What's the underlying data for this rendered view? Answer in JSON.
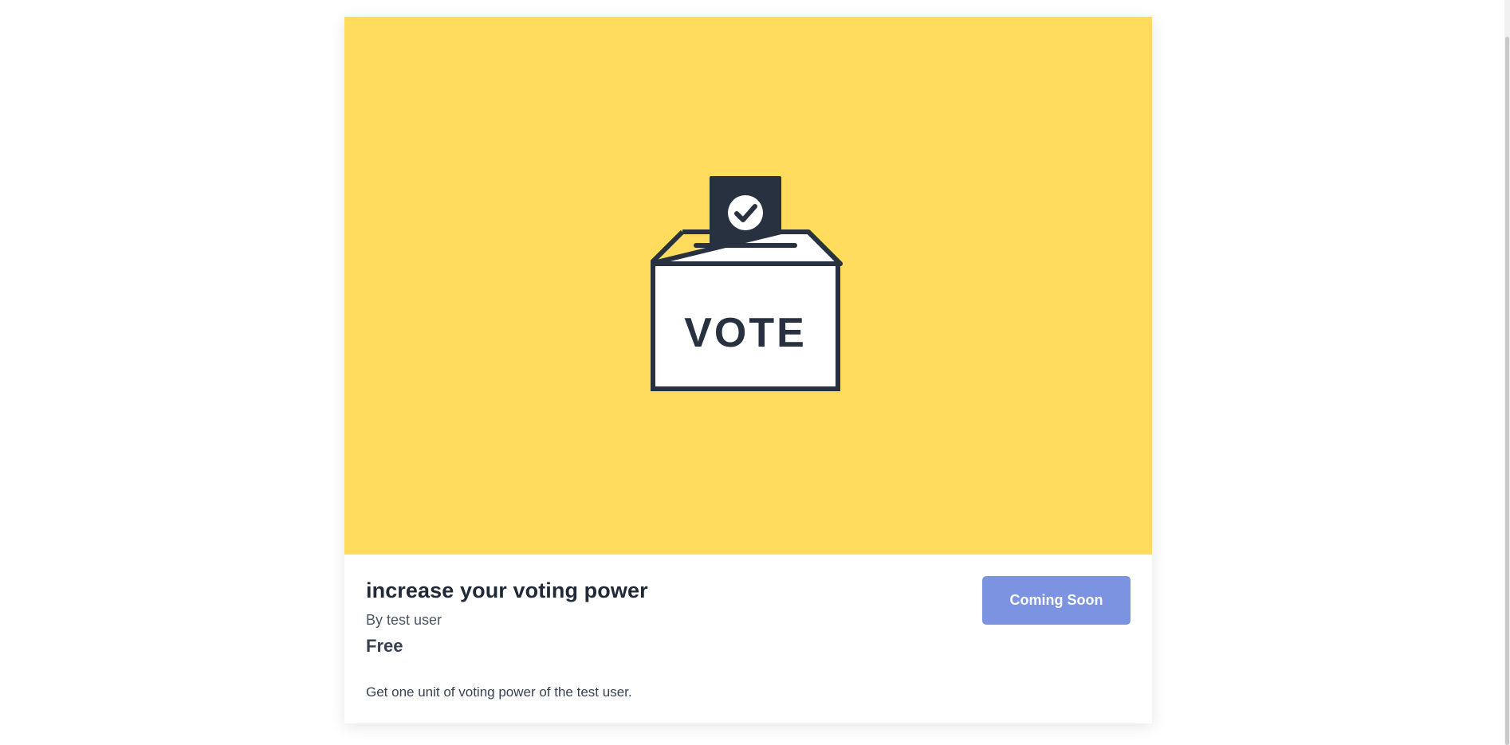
{
  "product": {
    "image_alt": "VOTE",
    "image_text": "VOTE",
    "title": "increase your voting power",
    "author": "By test user",
    "price": "Free",
    "description": "Get one unit of voting power of the test user.",
    "button_label": "Coming Soon"
  },
  "colors": {
    "image_background": "#ffdc5e",
    "button_background": "#7b93e0",
    "illustration_stroke": "#28313f"
  },
  "icons": {
    "illustration": "ballot-box-icon",
    "check": "check-circle-icon"
  }
}
